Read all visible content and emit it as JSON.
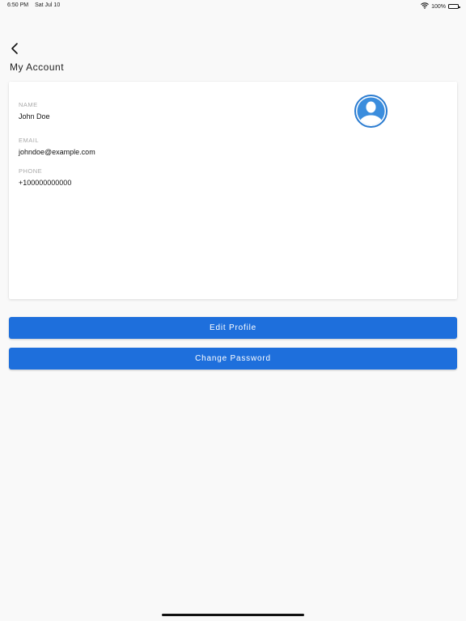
{
  "status_bar": {
    "time": "6:50 PM",
    "date": "Sat Jul 10",
    "battery": "100%"
  },
  "header": {
    "title": "My Account"
  },
  "profile": {
    "name_label": "NAME",
    "name_value": "John Doe",
    "email_label": "EMAIL",
    "email_value": "johndoe@example.com",
    "phone_label": "PHONE",
    "phone_value": "+100000000000"
  },
  "actions": {
    "edit_profile": "Edit Profile",
    "change_password": "Change Password"
  },
  "colors": {
    "accent": "#1e6fdc",
    "avatar": "#3b8ddd",
    "background": "#f9f9f9"
  }
}
